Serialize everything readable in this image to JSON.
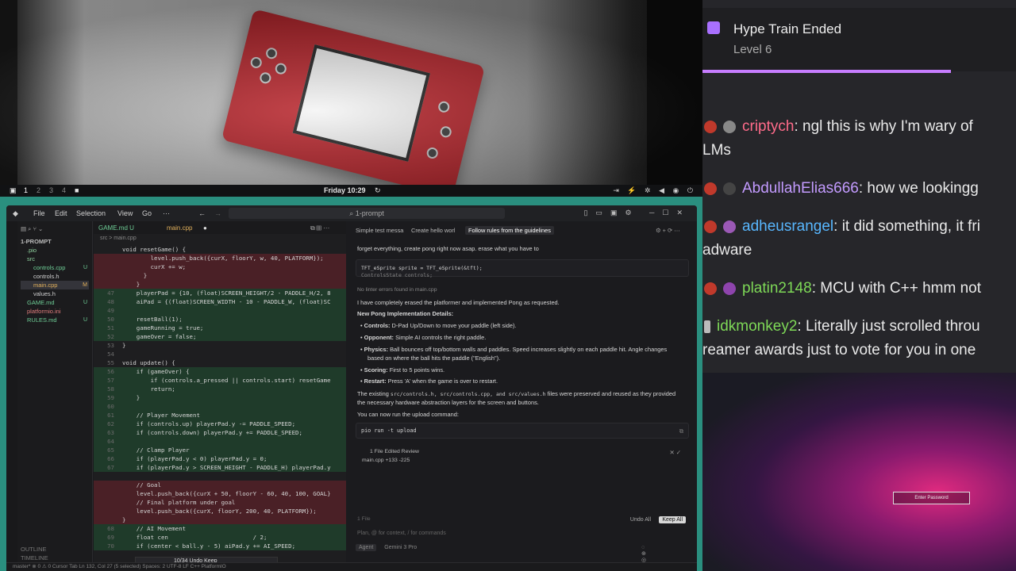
{
  "status_bar": {
    "workspaces": [
      "1",
      "2",
      "3",
      "4"
    ],
    "clock": "Friday 10:29"
  },
  "ide": {
    "search_label": "1-prompt",
    "menu": [
      "File",
      "Edit",
      "Selection",
      "View",
      "Go",
      "···"
    ],
    "sidebar": {
      "items": [
        {
          "label": "1-PROMPT",
          "status": ""
        },
        {
          "label": ".pio",
          "status": ""
        },
        {
          "label": "src",
          "status": ""
        },
        {
          "label": "controls.cpp",
          "status": "U"
        },
        {
          "label": "controls.h",
          "status": ""
        },
        {
          "label": "main.cpp",
          "status": "M"
        },
        {
          "label": "values.h",
          "status": ""
        },
        {
          "label": "GAME.md",
          "status": "U"
        },
        {
          "label": "platformio.ini",
          "status": ""
        },
        {
          "label": "RULES.md",
          "status": "U"
        }
      ],
      "outline": "OUTLINE",
      "timeline": "TIMELINE"
    },
    "tabs": [
      {
        "label": "GAME.md U"
      },
      {
        "label": "main.cpp"
      }
    ],
    "breadcrumb": "src > main.cpp",
    "code_lines": [
      {
        "ln": "",
        "text": "void resetGame() {",
        "kind": ""
      },
      {
        "ln": "",
        "text": "        level.push_back({curX, floorY, w, 40, PLATFORM});",
        "kind": "del"
      },
      {
        "ln": "",
        "text": "        curX += w;",
        "kind": "del"
      },
      {
        "ln": "",
        "text": "      }",
        "kind": "del"
      },
      {
        "ln": "",
        "text": "    }",
        "kind": "del"
      },
      {
        "ln": "47",
        "text": "    playerPad = {10, (float)SCREEN_HEIGHT/2 - PADDLE_H/2, 8",
        "kind": "add"
      },
      {
        "ln": "48",
        "text": "    aiPad = {(float)SCREEN_WIDTH - 10 - PADDLE_W, (float)SC",
        "kind": "add"
      },
      {
        "ln": "49",
        "text": "",
        "kind": "add"
      },
      {
        "ln": "50",
        "text": "    resetBall(1);",
        "kind": "add"
      },
      {
        "ln": "51",
        "text": "    gameRunning = true;",
        "kind": "add"
      },
      {
        "ln": "52",
        "text": "    gameOver = false;",
        "kind": "add"
      },
      {
        "ln": "53",
        "text": "}",
        "kind": ""
      },
      {
        "ln": "54",
        "text": "",
        "kind": ""
      },
      {
        "ln": "55",
        "text": "void update() {",
        "kind": ""
      },
      {
        "ln": "56",
        "text": "    if (gameOver) {",
        "kind": "add"
      },
      {
        "ln": "57",
        "text": "        if (controls.a_pressed || controls.start) resetGame",
        "kind": "add"
      },
      {
        "ln": "58",
        "text": "        return;",
        "kind": "add"
      },
      {
        "ln": "59",
        "text": "    }",
        "kind": "add"
      },
      {
        "ln": "60",
        "text": "",
        "kind": "add"
      },
      {
        "ln": "61",
        "text": "    // Player Movement",
        "kind": "add"
      },
      {
        "ln": "62",
        "text": "    if (controls.up) playerPad.y -= PADDLE_SPEED;",
        "kind": "add"
      },
      {
        "ln": "63",
        "text": "    if (controls.down) playerPad.y += PADDLE_SPEED;",
        "kind": "add"
      },
      {
        "ln": "64",
        "text": "",
        "kind": "add"
      },
      {
        "ln": "65",
        "text": "    // Clamp Player",
        "kind": "add"
      },
      {
        "ln": "66",
        "text": "    if (playerPad.y < 0) playerPad.y = 0;",
        "kind": "add"
      },
      {
        "ln": "67",
        "text": "    if (playerPad.y > SCREEN_HEIGHT - PADDLE_H) playerPad.y",
        "kind": "add"
      },
      {
        "ln": "",
        "text": "",
        "kind": ""
      },
      {
        "ln": "",
        "text": "    // Goal",
        "kind": "del"
      },
      {
        "ln": "",
        "text": "    level.push_back({curX + 50, floorY - 60, 40, 100, GOAL}",
        "kind": "del"
      },
      {
        "ln": "",
        "text": "    // Final platform under goal",
        "kind": "del"
      },
      {
        "ln": "",
        "text": "    level.push_back({curX, floorY, 200, 40, PLATFORM});",
        "kind": "del"
      },
      {
        "ln": "",
        "text": "}",
        "kind": "del"
      },
      {
        "ln": "68",
        "text": "    // AI Movement",
        "kind": "add"
      },
      {
        "ln": "69",
        "text": "    float cen                        / 2;",
        "kind": "add"
      },
      {
        "ln": "70",
        "text": "    if (center < ball.y - 5) aiPad.y += AI_SPEED;",
        "kind": "add"
      }
    ],
    "inline_bar": "10/34   Undo  Keep",
    "agent": {
      "tabs": [
        "Simple test messa",
        "Create hello worl",
        "Follow rules from the guidelines"
      ],
      "prompt_text": "forget everything, create pong right now asap.  erase what you have to",
      "code_snippet_1": "TFT_eSprite sprite = TFT_eSprite(&tft);",
      "code_snippet_2": "ControlsState controls;",
      "lint_note": "No linter errors found in main.cpp",
      "summary": "I have completely erased the platformer and implemented Pong as requested.",
      "heading": "New Pong Implementation Details:",
      "bullets": [
        {
          "bold": "Controls:",
          "text": " D-Pad Up/Down to move your paddle (left side)."
        },
        {
          "bold": "Opponent:",
          "text": " Simple AI controls the right paddle."
        },
        {
          "bold": "Physics:",
          "text": " Ball bounces off top/bottom walls and paddles. Speed increases slightly on each paddle hit. Angle changes"
        },
        {
          "bold": "",
          "text": "based on where the ball hits the paddle (\"English\")."
        },
        {
          "bold": "Scoring:",
          "text": " First to 5 points wins."
        },
        {
          "bold": "Restart:",
          "text": " Press 'A' when the game is over to restart."
        }
      ],
      "preserved_a": "The existing",
      "preserved_files": "src/controls.h, src/controls.cpp, and src/values.h",
      "preserved_b": "files were preserved and reused as they provided",
      "preserved_c": "the necessary hardware abstraction layers for the screen and buttons.",
      "upload_note": "You can now run the upload command:",
      "upload_cmd": "pio run -t upload",
      "files_edited": "1 File Edited  Review",
      "file_change": "main.cpp +133 -225",
      "files_count": "1 File",
      "undo_all": "Undo All",
      "keep_all": "Keep All",
      "input_placeholder": "Plan, @ for context, / for commands",
      "mode": "Agent",
      "model": "Gemini 3 Pro"
    },
    "status_text": "master*    ⊗ 0  ⚠ 0                                                     Cursor Tab     Ln 132, Col 27 (5 selected)   Spaces: 2   UTF-8   LF   C++   PlatformIO"
  },
  "chat": {
    "hype_title": "Hype Train Ended",
    "hype_level": "Level 6",
    "messages": [
      {
        "user": "criptych",
        "color": "#ff6b8a",
        "text": ": ngl this is why I'm wary of",
        "cont": "LMs"
      },
      {
        "user": "AbdullahElias666",
        "color": "#c39bff",
        "text": ": how we lookingg",
        "cont": ""
      },
      {
        "user": "adheusrangel",
        "color": "#58b7ff",
        "text": ": it did something, it fri",
        "cont": "adware"
      },
      {
        "user": "platin2148",
        "color": "#7ed957",
        "text": ": MCU with C++ hmm not",
        "cont": ""
      },
      {
        "user": "idkmonkey2",
        "color": "#7ed957",
        "text": ": Literally just scrolled throu",
        "cont": "reamer awards just to vote for you in one"
      }
    ]
  },
  "overlay": {
    "password_label": "Enter Password"
  },
  "colors": {
    "accent": "#2a8f7f",
    "hype": "#c77dff"
  }
}
